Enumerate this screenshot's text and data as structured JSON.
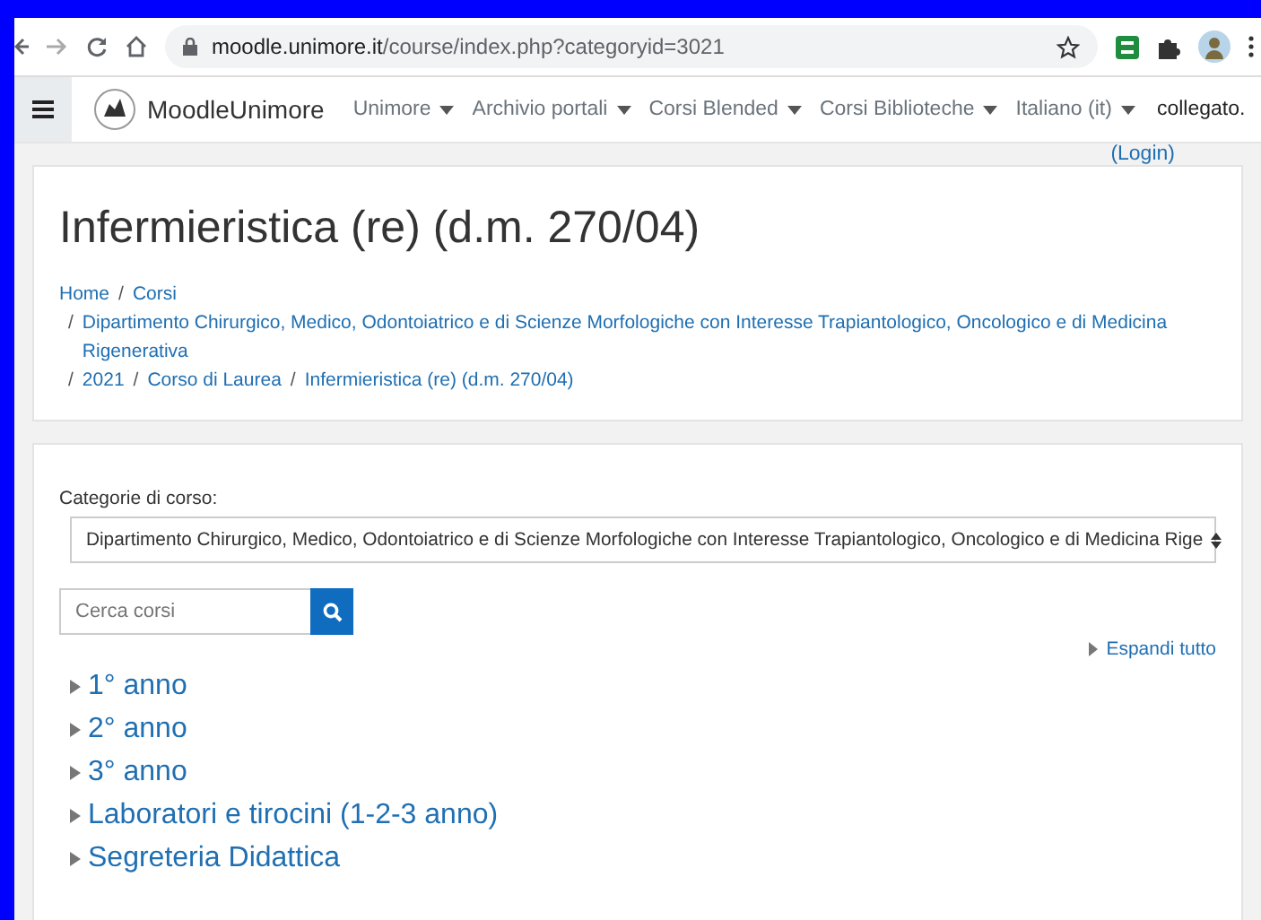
{
  "browser": {
    "url_domain": "moodle.unimore.it",
    "url_path": "/course/index.php?categoryid=3021"
  },
  "navbar": {
    "brand": "MoodleUnimore",
    "menus": [
      {
        "label": "Unimore"
      },
      {
        "label": "Archivio portali"
      },
      {
        "label": "Corsi Blended"
      },
      {
        "label": "Corsi Biblioteche"
      },
      {
        "label": "Italiano (it)"
      }
    ],
    "status": "collegato.",
    "login": "(Login)"
  },
  "header": {
    "title": "Infermieristica (re) (d.m. 270/04)",
    "breadcrumb": [
      [
        {
          "label": "Home"
        },
        {
          "prefix": "/",
          "label": "Corsi"
        }
      ],
      [
        {
          "prefix": "/",
          "label": "Dipartimento Chirurgico, Medico, Odontoiatrico e di Scienze Morfologiche con Interesse Trapiantologico, Oncologico e di Medicina Rigenerativa"
        }
      ],
      [
        {
          "prefix": "/",
          "label": "2021"
        },
        {
          "prefix": "/",
          "label": "Corso di Laurea"
        },
        {
          "prefix": "/",
          "label": "Infermieristica (re) (d.m. 270/04)"
        }
      ]
    ]
  },
  "categories": {
    "label": "Categorie di corso:",
    "value": "Dipartimento Chirurgico, Medico, Odontoiatrico e di Scienze Morfologiche con Interesse Trapiantologico, Oncologico e di Medicina Rige"
  },
  "search": {
    "placeholder": "Cerca corsi"
  },
  "expand_all": "Espandi tutto",
  "tree": [
    {
      "label": "1° anno",
      "expanded": false
    },
    {
      "label": "2° anno",
      "expanded": false
    },
    {
      "label": "3° anno",
      "expanded": false
    },
    {
      "label": "Laboratori e tirocini (1-2-3 anno)",
      "expanded": false
    },
    {
      "label": "Segreteria Didattica",
      "expanded": false
    }
  ]
}
